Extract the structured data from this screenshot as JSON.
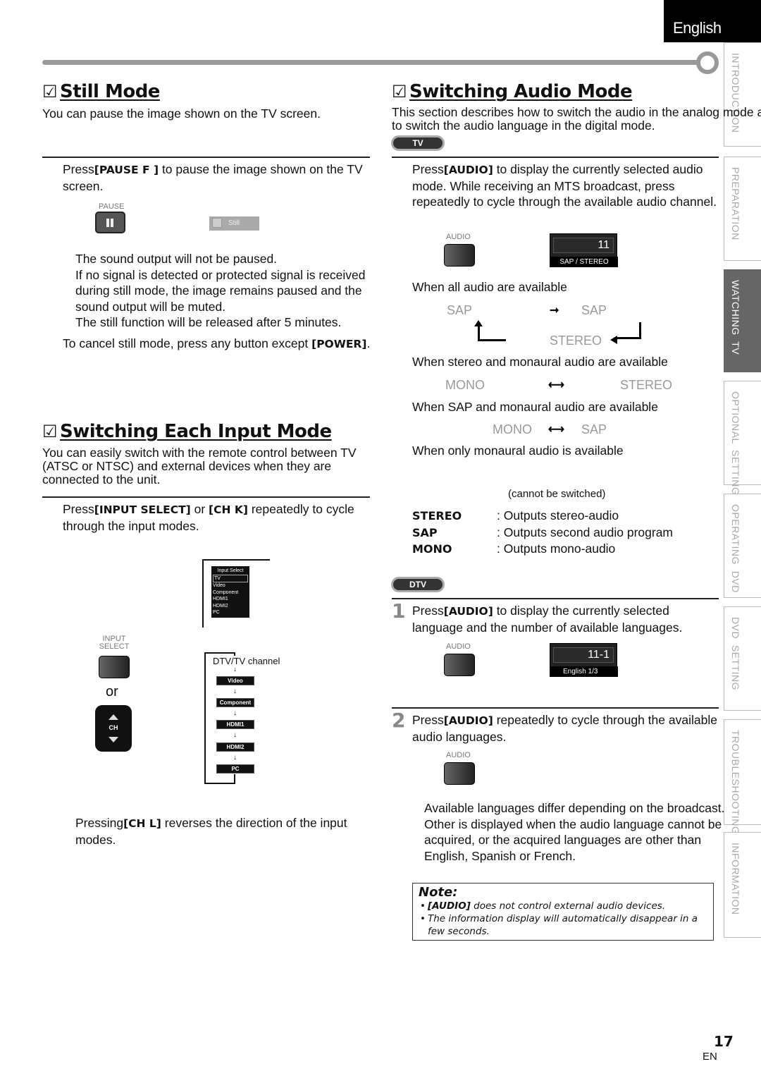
{
  "header": {
    "language_tab": "English"
  },
  "side_tabs": [
    {
      "label": "INTRODUCTION",
      "active": false
    },
    {
      "label": "PREPARATION",
      "active": false
    },
    {
      "label": "WATCHING  TV",
      "active": true
    },
    {
      "label": "OPTIONAL  SETTING",
      "active": false
    },
    {
      "label": "OPERATING  DVD",
      "active": false
    },
    {
      "label": "DVD  SETTING",
      "active": false
    },
    {
      "label": "TROUBLESHOOTING",
      "active": false
    },
    {
      "label": "INFORMATION",
      "active": false
    }
  ],
  "still_mode": {
    "checkbox": "☑",
    "title": "Still Mode",
    "intro": "You can pause the image shown on the TV screen.",
    "step_pre": "Press",
    "step_key": "[PAUSE F ]",
    "step_post": " to pause the image shown on the TV screen.",
    "pause_button_label": "PAUSE",
    "osd_label": "Still",
    "notes": [
      "The sound output will not be paused.",
      "If no signal is detected or protected signal is received during still mode, the image remains paused and the sound output will be muted.",
      "The still function will be released after 5 minutes."
    ],
    "cancel_pre": "To cancel still mode, press any button except ",
    "cancel_key": "[POWER]",
    "cancel_post": "."
  },
  "input_mode": {
    "checkbox": "☑",
    "title": "Switching Each Input Mode",
    "intro": "You can easily switch with the remote control between TV (ATSC or NTSC) and external devices when they are connected to the unit.",
    "step_pre": "Press",
    "step_key1": "[INPUT SELECT]",
    "step_or": " or ",
    "step_key2": "[CH K]",
    "step_post": " repeatedly to cycle through the input modes.",
    "input_select_label": "INPUT\nSELECT",
    "or_label": "or",
    "ch_label": "CH",
    "menu_title": "Input Select",
    "menu_items": [
      "TV",
      "Video",
      "Component",
      "HDMI1",
      "HDMI2",
      "PC"
    ],
    "menu_selected": "TV",
    "flow_start": "DTV/TV channel",
    "flow_items": [
      "Video",
      "Component",
      "HDMI1",
      "HDMI2",
      "PC"
    ],
    "reverse_pre": "Pressing",
    "reverse_key": "[CH L]",
    "reverse_post": " reverses the direction of the input modes."
  },
  "audio_mode": {
    "checkbox": "☑",
    "title": "Switching Audio Mode",
    "intro": "This section describes how to switch the audio in the analog mode and how to switch the audio language in the digital mode.",
    "tv_badge": "TV",
    "tv_step_pre": "Press",
    "tv_step_key": "[AUDIO]",
    "tv_step_post": " to display the currently selected audio mode. While receiving an MTS broadcast, press repeatedly to cycle through the available audio channel.",
    "audio_button_label": "AUDIO",
    "osd_channel": "11",
    "osd_mode": "SAP / STEREO",
    "case_all": "When all audio are available",
    "case_all_words": [
      "SAP",
      "SAP",
      "STEREO"
    ],
    "case_stereo_mono": "When stereo and monaural audio are available",
    "case_stereo_mono_words": [
      "MONO",
      "STEREO"
    ],
    "case_sap_mono": "When SAP and monaural audio are available",
    "case_sap_mono_words": [
      "MONO",
      "SAP"
    ],
    "case_mono_only": "When only monaural audio is available",
    "cannot_switch": "(cannot be switched)",
    "legend": [
      {
        "term": "STEREO",
        "desc": ": Outputs stereo-audio"
      },
      {
        "term": "SAP",
        "desc": ": Outputs second audio program"
      },
      {
        "term": "MONO",
        "desc": ": Outputs mono-audio"
      }
    ],
    "dtv_badge": "DTV",
    "dtv_step1_num": "1",
    "dtv_step1_pre": "Press",
    "dtv_step1_key": "[AUDIO]",
    "dtv_step1_post": " to display the currently selected language and the number of available languages.",
    "dtv_osd_channel": "11-1",
    "dtv_osd_lang": "English 1/3",
    "dtv_step2_num": "2",
    "dtv_step2_pre": "Press",
    "dtv_step2_key": "[AUDIO]",
    "dtv_step2_post": " repeatedly to cycle through the available audio languages.",
    "languages_note": "Available languages differ depending on the broadcast.  Other  is displayed when the audio language cannot be acquired, or the acquired languages are other than English, Spanish or French."
  },
  "note": {
    "title": "Note:",
    "item1_key": "[AUDIO]",
    "item1_text": " does not control external audio devices.",
    "item2_text": "The information display will automatically disappear in a few seconds."
  },
  "footer": {
    "page_number": "17",
    "lang_code": "EN"
  }
}
